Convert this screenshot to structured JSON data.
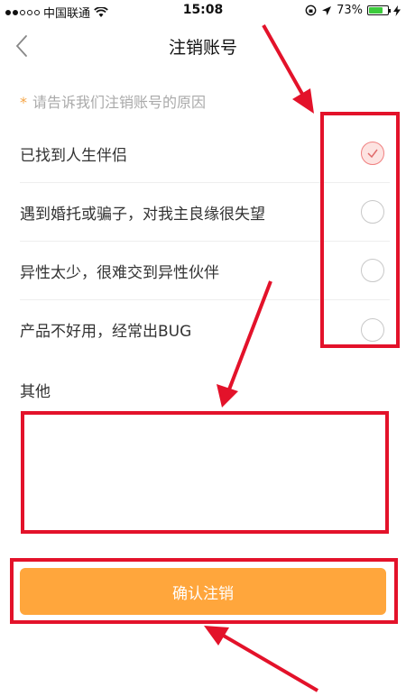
{
  "status_bar": {
    "carrier": "中国联通",
    "time": "15:08",
    "battery": "73%",
    "battery_level": 0.73
  },
  "nav": {
    "title": "注销账号"
  },
  "form": {
    "hint": "请告诉我们注销账号的原因",
    "hint_marker": "*",
    "reasons": [
      {
        "label": "已找到人生伴侣",
        "checked": true
      },
      {
        "label": "遇到婚托或骗子，对我主良缘很失望",
        "checked": false
      },
      {
        "label": "异性太少，很难交到异性伙伴",
        "checked": false
      },
      {
        "label": "产品不好用，经常出BUG",
        "checked": false
      }
    ],
    "other_label": "其他",
    "other_value": "",
    "confirm_label": "确认注销"
  },
  "colors": {
    "accent": "#ffa63c",
    "annotation": "#e3122a",
    "radio_checked": "#f08080"
  }
}
